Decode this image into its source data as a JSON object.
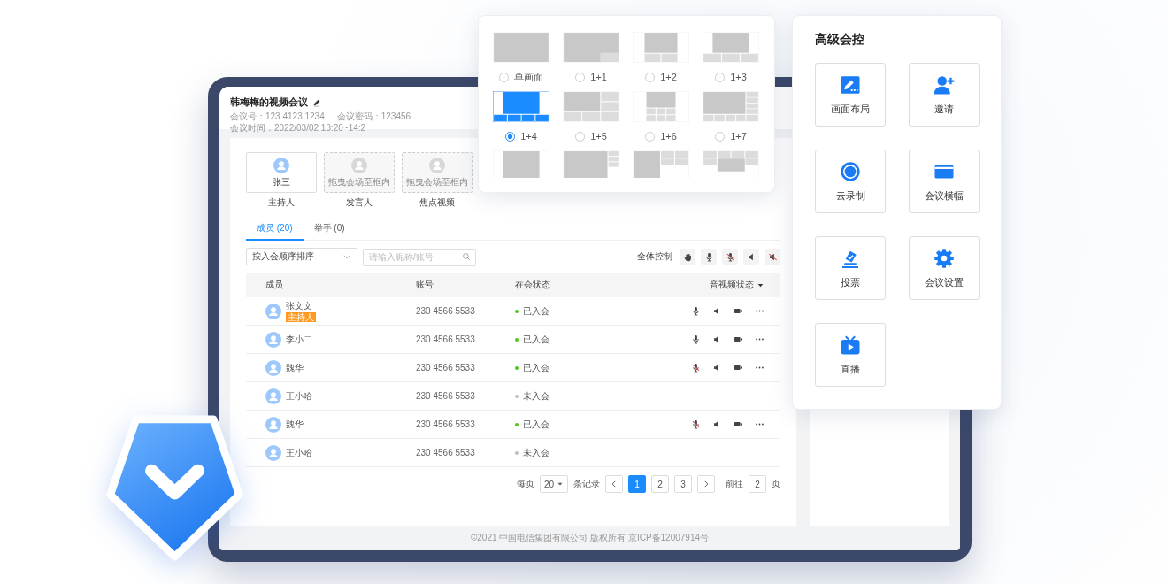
{
  "meeting": {
    "title": "韩梅梅的视频会议",
    "meta": [
      "会议号：123 4123 1234",
      "会议密码：123456",
      "会议时间：2022/03/02 13:20~14:2"
    ]
  },
  "role_slots": [
    {
      "kind": "filled",
      "name": "张三",
      "label": "主持人"
    },
    {
      "kind": "empty",
      "hint": "拖曳会场至框内",
      "label": "发言人"
    },
    {
      "kind": "empty",
      "hint": "拖曳会场至框内",
      "label": "焦点视频"
    }
  ],
  "tabs": [
    {
      "label": "成员 (20)",
      "selected": true
    },
    {
      "label": "举手 (0)",
      "selected": false
    }
  ],
  "sort_select": {
    "value": "按入会顺序排序"
  },
  "search": {
    "placeholder": "请输入昵称/账号"
  },
  "all_control": {
    "label": "全体控制",
    "buttons": [
      {
        "kind": "hand"
      },
      {
        "kind": "mic"
      },
      {
        "kind": "mic-off"
      },
      {
        "kind": "speaker"
      },
      {
        "kind": "speaker-off"
      }
    ]
  },
  "table": {
    "columns": [
      "成员",
      "账号",
      "在会状态",
      "音视频状态"
    ],
    "rows": [
      {
        "name": "张文文",
        "tag": "主持人",
        "account": "230 4566 5533",
        "status": "已入会",
        "joined": true,
        "controls": [
          {
            "kind": "mic"
          },
          {
            "kind": "speaker"
          },
          {
            "kind": "camera"
          },
          {
            "kind": "more"
          }
        ]
      },
      {
        "name": "李小二",
        "account": "230 4566 5533",
        "status": "已入会",
        "joined": true,
        "controls": [
          {
            "kind": "mic"
          },
          {
            "kind": "speaker"
          },
          {
            "kind": "camera"
          },
          {
            "kind": "more"
          }
        ]
      },
      {
        "name": "魏华",
        "account": "230 4566 5533",
        "status": "已入会",
        "joined": true,
        "controls": [
          {
            "kind": "mic-off"
          },
          {
            "kind": "speaker"
          },
          {
            "kind": "camera"
          },
          {
            "kind": "more"
          }
        ]
      },
      {
        "name": "王小哈",
        "account": "230 4566 5533",
        "status": "未入会",
        "joined": false
      },
      {
        "name": "魏华",
        "account": "230 4566 5533",
        "status": "已入会",
        "joined": true,
        "controls": [
          {
            "kind": "mic-off"
          },
          {
            "kind": "speaker"
          },
          {
            "kind": "camera"
          },
          {
            "kind": "more"
          }
        ]
      },
      {
        "name": "王小哈",
        "account": "230 4566 5533",
        "status": "未入会",
        "joined": false
      }
    ]
  },
  "pagination": {
    "per_page_label": "每页",
    "per_page": "20",
    "records_label": "条记录",
    "pages": [
      {
        "label": "1",
        "selected": true
      },
      {
        "label": "2",
        "selected": false
      },
      {
        "label": "3",
        "selected": false
      }
    ],
    "goto_label": "前往",
    "goto_value": "2",
    "page_unit": "页"
  },
  "footer": "©2021 中国电信集团有限公司 版权所有 京ICP备12007914号",
  "layout_picker": {
    "options": [
      {
        "label": "单画面",
        "selected": false
      },
      {
        "label": "1+1",
        "selected": false
      },
      {
        "label": "1+2",
        "selected": false
      },
      {
        "label": "1+3",
        "selected": false
      },
      {
        "label": "1+4",
        "selected": true
      },
      {
        "label": "1+5",
        "selected": false
      },
      {
        "label": "1+6",
        "selected": false
      },
      {
        "label": "1+7",
        "selected": false
      },
      {
        "selected": false
      },
      {
        "selected": false
      },
      {
        "selected": false
      },
      {
        "selected": false
      }
    ]
  },
  "advanced_control": {
    "title": "高级会控",
    "tiles": [
      {
        "label": "画面布局",
        "kind": "layout"
      },
      {
        "label": "邀请",
        "kind": "invite"
      },
      {
        "label": "云录制",
        "kind": "record"
      },
      {
        "label": "会议横幅",
        "kind": "banner"
      },
      {
        "label": "投票",
        "kind": "vote"
      },
      {
        "label": "会议设置",
        "kind": "settings"
      },
      {
        "label": "直播",
        "kind": "live"
      }
    ]
  }
}
